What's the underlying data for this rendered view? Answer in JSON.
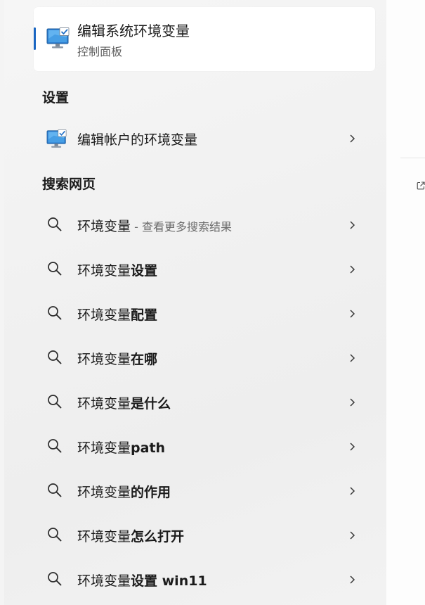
{
  "best_match": {
    "title": "编辑系统环境变量",
    "subtitle": "控制面板"
  },
  "sections": {
    "settings_heading": "设置",
    "web_heading": "搜索网页"
  },
  "settings_items": [
    {
      "label": "编辑帐户的环境变量"
    }
  ],
  "web_items": [
    {
      "prefix": "环境变量",
      "suffix": "",
      "hint": " - 查看更多搜索结果"
    },
    {
      "prefix": "环境变量",
      "suffix": "设置",
      "hint": ""
    },
    {
      "prefix": "环境变量",
      "suffix": "配置",
      "hint": ""
    },
    {
      "prefix": "环境变量",
      "suffix": "在哪",
      "hint": ""
    },
    {
      "prefix": "环境变量",
      "suffix": "是什么",
      "hint": ""
    },
    {
      "prefix": "环境变量",
      "suffix": "path",
      "hint": ""
    },
    {
      "prefix": "环境变量",
      "suffix": "的作用",
      "hint": ""
    },
    {
      "prefix": "环境变量",
      "suffix": "怎么打开",
      "hint": ""
    },
    {
      "prefix": "环境变量",
      "suffix": "设置 win11",
      "hint": ""
    }
  ],
  "icons": {
    "best_match": "monitor-checkmark-icon",
    "settings": "monitor-checkmark-icon",
    "web": "search-icon",
    "chevron": "chevron-right-icon",
    "open_external": "open-external-icon"
  },
  "colors": {
    "accent": "#1a66c2",
    "panel_bg": "#f3f3f3",
    "card_bg": "#ffffff",
    "text": "#1b1b1b",
    "muted": "#5f5f5f"
  }
}
